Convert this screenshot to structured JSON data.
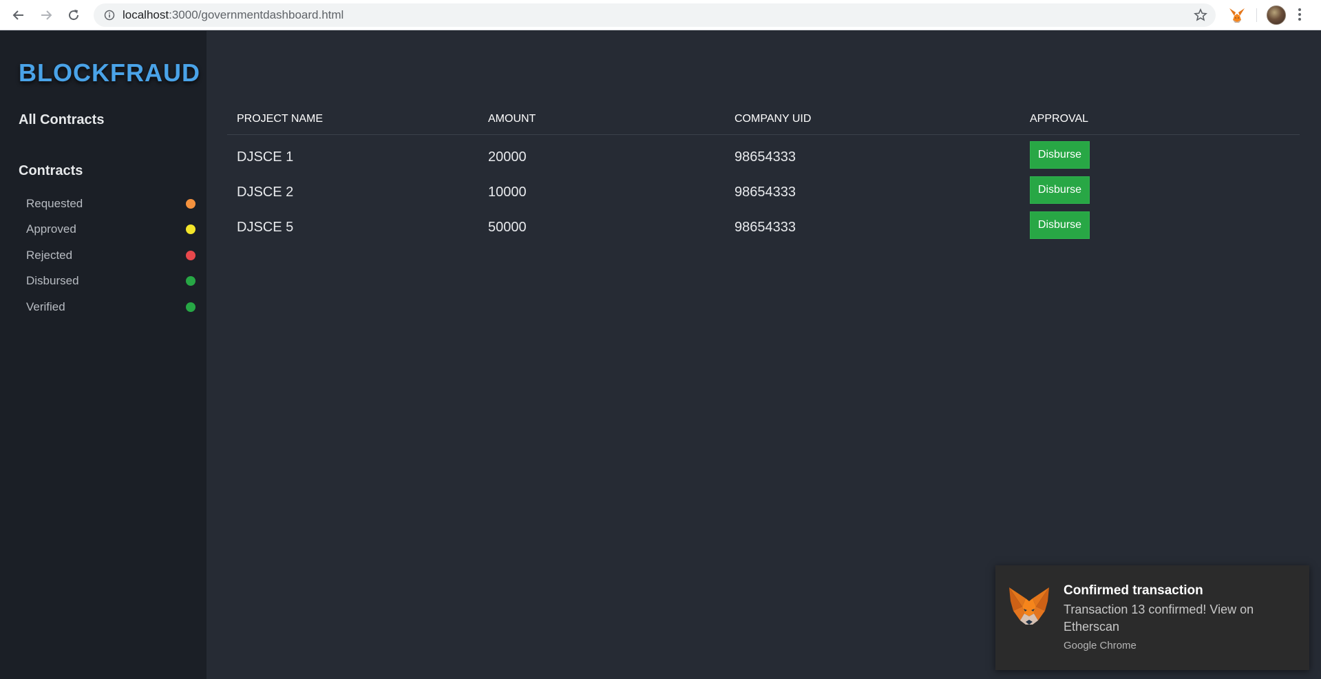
{
  "browser": {
    "url_host": "localhost",
    "url_path": ":3000/governmentdashboard.html",
    "icons": [
      "back-arrow-icon",
      "forward-arrow-icon",
      "reload-icon",
      "info-icon",
      "star-icon",
      "metamask-fox-icon",
      "avatar",
      "kebab-menu-icon"
    ]
  },
  "sidebar": {
    "brand": "BLOCKFRAUD",
    "all_contracts": "All Contracts",
    "contracts_heading": "Contracts",
    "statuses": [
      {
        "label": "Requested",
        "color": "#f5923e"
      },
      {
        "label": "Approved",
        "color": "#f3e52a"
      },
      {
        "label": "Rejected",
        "color": "#e8484c"
      },
      {
        "label": "Disbursed",
        "color": "#27a745"
      },
      {
        "label": "Verified",
        "color": "#27a745"
      }
    ]
  },
  "table": {
    "headers": [
      "PROJECT NAME",
      "AMOUNT",
      "COMPANY UID",
      "APPROVAL"
    ],
    "rows": [
      {
        "project": "DJSCE 1",
        "amount": "20000",
        "uid": "98654333",
        "action": "Disburse"
      },
      {
        "project": "DJSCE 2",
        "amount": "10000",
        "uid": "98654333",
        "action": "Disburse"
      },
      {
        "project": "DJSCE 5",
        "amount": "50000",
        "uid": "98654333",
        "action": "Disburse"
      }
    ]
  },
  "notification": {
    "title": "Confirmed transaction",
    "body": "Transaction 13 confirmed! View on Etherscan",
    "source": "Google Chrome"
  },
  "colors": {
    "accent_blue": "#4aa3e8",
    "button_green": "#28a745",
    "main_bg": "#262b34",
    "sidebar_bg": "#1b1f26"
  }
}
